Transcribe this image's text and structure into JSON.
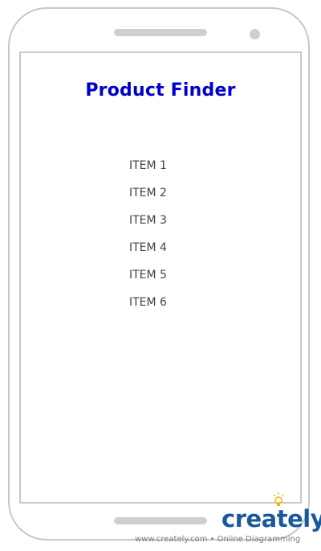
{
  "app": {
    "title": "Product Finder"
  },
  "items": [
    {
      "label": "ITEM 1"
    },
    {
      "label": "ITEM 2"
    },
    {
      "label": "ITEM 3"
    },
    {
      "label": "ITEM 4"
    },
    {
      "label": "ITEM 5"
    },
    {
      "label": "ITEM 6"
    }
  ],
  "watermark": {
    "logo": "creately",
    "tagline": "www.creately.com • Online Diagramming"
  },
  "colors": {
    "title": "#0000cc",
    "frame": "#c8c8c8",
    "item_text": "#444444",
    "logo": "#1a5a9c",
    "bulb": "#f5b800"
  }
}
